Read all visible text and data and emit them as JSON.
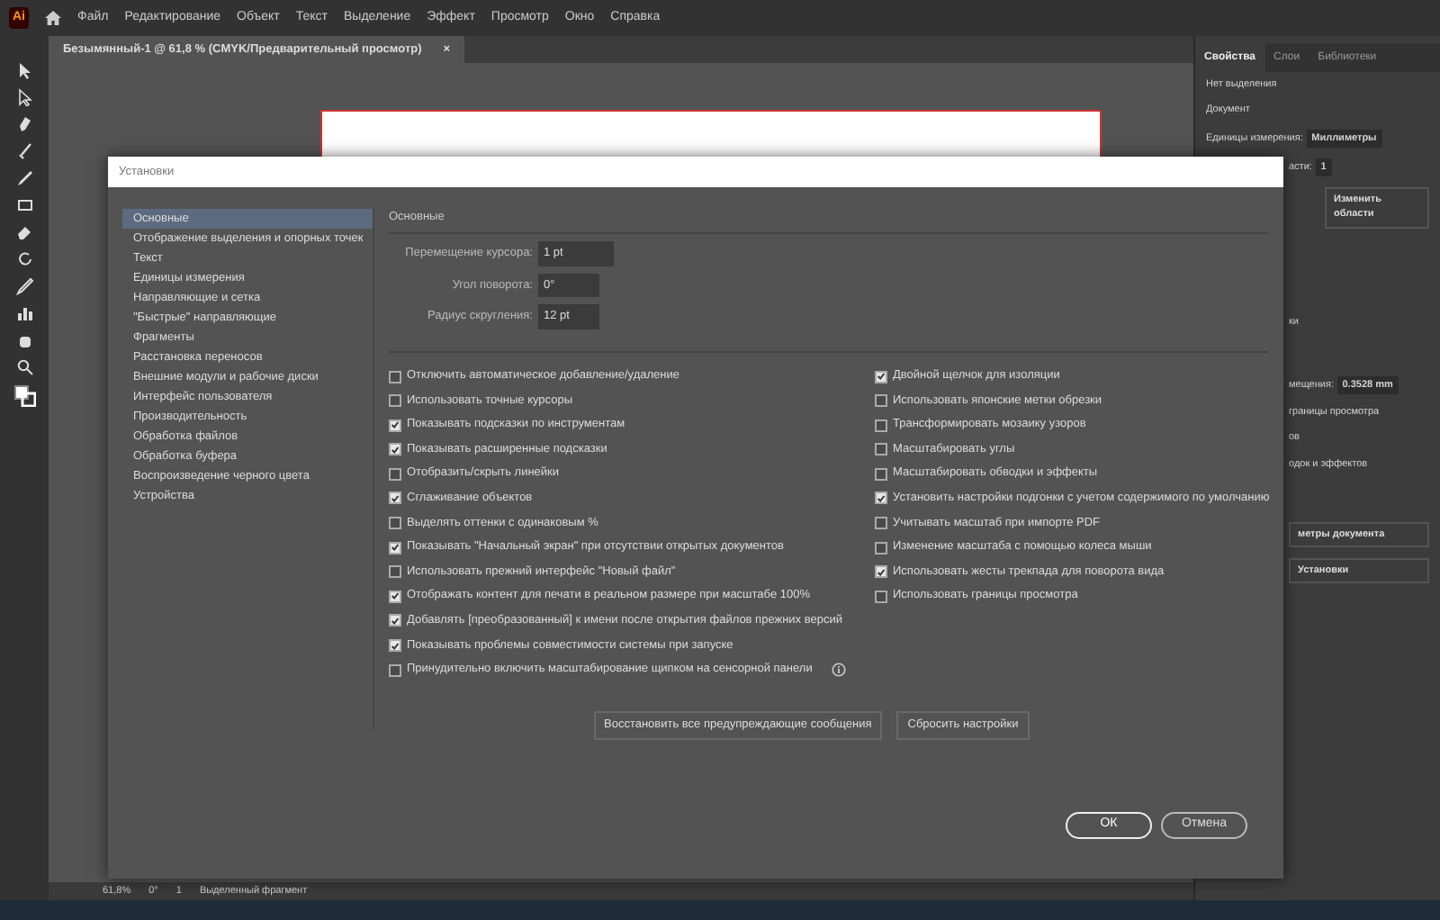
{
  "menu_bar": {
    "logo": "Ai",
    "items": [
      "Файл",
      "Редактирование",
      "Объект",
      "Текст",
      "Выделение",
      "Эффект",
      "Просмотр",
      "Окно",
      "Справка"
    ]
  },
  "document_tab": {
    "title": "Безымянный-1 @ 61,8 % (CMYK/Предварительный просмотр)",
    "close": "×"
  },
  "properties_panel": {
    "tabs": [
      {
        "label": "Свойства",
        "selected": true
      },
      {
        "label": "Слои",
        "selected": false
      },
      {
        "label": "Библиотеки",
        "selected": false
      }
    ],
    "no_selection": "Нет выделения",
    "document_heading": "Документ",
    "units_label": "Единицы измерения:",
    "units_value": "Миллиметры",
    "artboard_label_fragment": "асти:",
    "artboard_value": "1",
    "edit_artboards_button": "Изменить области",
    "snap_fragment": "ки",
    "offset_label_fragment": "мещения:",
    "offset_value": "0.3528 mm",
    "option_fragments": [
      "границы просмотра",
      "ов",
      "одок и эффектов"
    ],
    "button_fragments": [
      "метры документа",
      "Установки"
    ]
  },
  "status_bar": {
    "zoom": "61,8%",
    "rotation": "0°",
    "artboard": "1",
    "tool": "Выделенный фрагмент"
  },
  "dialog": {
    "title": "Установки",
    "categories": [
      {
        "label": "Основные",
        "selected": true
      },
      {
        "label": "Отображение выделения и опорных точек",
        "selected": false
      },
      {
        "label": "Текст",
        "selected": false
      },
      {
        "label": "Единицы измерения",
        "selected": false
      },
      {
        "label": "Направляющие и сетка",
        "selected": false
      },
      {
        "label": "\"Быстрые\" направляющие",
        "selected": false
      },
      {
        "label": "Фрагменты",
        "selected": false
      },
      {
        "label": "Расстановка переносов",
        "selected": false
      },
      {
        "label": "Внешние модули и рабочие диски",
        "selected": false
      },
      {
        "label": "Интерфейс пользователя",
        "selected": false
      },
      {
        "label": "Производительность",
        "selected": false
      },
      {
        "label": "Обработка файлов",
        "selected": false
      },
      {
        "label": "Обработка буфера",
        "selected": false
      },
      {
        "label": "Воспроизведение черного цвета",
        "selected": false
      },
      {
        "label": "Устройства",
        "selected": false
      }
    ],
    "section_title": "Основные",
    "fields": [
      {
        "label": "Перемещение курсора:",
        "value": "1 pt"
      },
      {
        "label": "Угол поворота:",
        "value": "0°"
      },
      {
        "label": "Радиус скругления:",
        "value": "12 pt"
      }
    ],
    "left_options": [
      {
        "label": "Отключить автоматическое добавление/удаление",
        "checked": false
      },
      {
        "label": "Использовать точные курсоры",
        "checked": false
      },
      {
        "label": "Показывать подсказки по инструментам",
        "checked": true
      },
      {
        "label": "Показывать расширенные подсказки",
        "checked": true
      },
      {
        "label": "Отобразить/скрыть линейки",
        "checked": false
      },
      {
        "label": "Сглаживание объектов",
        "checked": true
      },
      {
        "label": "Выделять оттенки с одинаковым %",
        "checked": false
      },
      {
        "label": "Показывать \"Начальный экран\" при отсутствии открытых документов",
        "checked": true
      },
      {
        "label": "Использовать прежний интерфейс \"Новый файл\"",
        "checked": false
      },
      {
        "label": "Отображать контент для печати в реальном размере при масштабе 100%",
        "checked": true
      },
      {
        "label": "Добавлять [преобразованный] к имени после открытия файлов прежних версий",
        "checked": true
      },
      {
        "label": "Показывать проблемы совместимости системы при запуске",
        "checked": true
      },
      {
        "label": "Принудительно включить масштабирование щипком на сенсорной панели",
        "checked": false,
        "info": true
      }
    ],
    "right_options": [
      {
        "label": "Двойной щелчок для изоляции",
        "checked": true
      },
      {
        "label": "Использовать японские метки обрезки",
        "checked": false
      },
      {
        "label": "Трансформировать мозаику узоров",
        "checked": false
      },
      {
        "label": "Масштабировать углы",
        "checked": false
      },
      {
        "label": "Масштабировать обводки и эффекты",
        "checked": false
      },
      {
        "label": "Установить настройки подгонки с учетом содержимого по умолчанию",
        "checked": true
      },
      {
        "label": "Учитывать масштаб при импорте PDF",
        "checked": false
      },
      {
        "label": "Изменение масштаба с помощью колеса мыши",
        "checked": false
      },
      {
        "label": "Использовать жесты трекпада для поворота вида",
        "checked": true
      },
      {
        "label": "Использовать границы просмотра",
        "checked": false
      }
    ],
    "action_buttons": [
      "Восстановить все предупреждающие сообщения",
      "Сбросить настройки"
    ],
    "ok_button": "ОК",
    "cancel_button": "Отмена"
  }
}
